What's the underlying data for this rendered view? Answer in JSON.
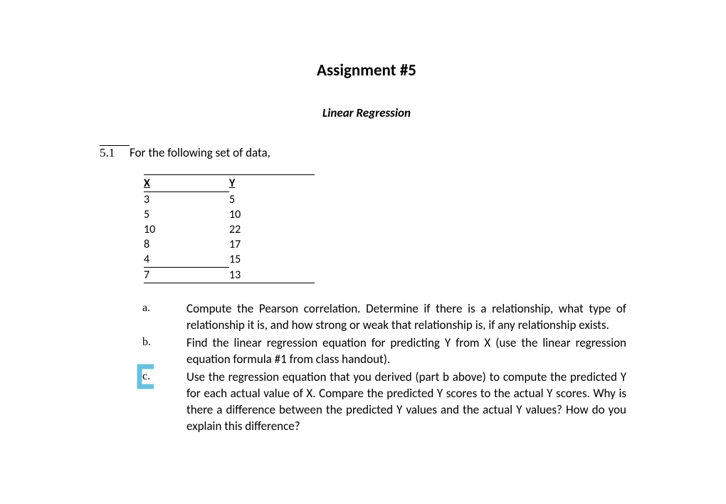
{
  "title": "Assignment #5",
  "subtitle": "Linear Regression",
  "question": {
    "number": "5.1",
    "text": "For the following set of data,"
  },
  "table": {
    "headers": {
      "x": "X",
      "y": "Y"
    },
    "rows": [
      {
        "x": "3",
        "y": "5"
      },
      {
        "x": "5",
        "y": "10"
      },
      {
        "x": "10",
        "y": "22"
      },
      {
        "x": "8",
        "y": "17"
      },
      {
        "x": "4",
        "y": "15"
      },
      {
        "x": "7",
        "y": "13"
      }
    ]
  },
  "parts": {
    "a": {
      "label": "a.",
      "text": "Compute the Pearson correlation. Determine if there is a relationship, what type of relationship it is, and how strong or weak that relationship is, if any relationship exists."
    },
    "b": {
      "label": "b.",
      "text": "Find the linear regression equation for predicting Y from X (use the linear regression equation formula #1 from class handout)."
    },
    "c": {
      "label": "c.",
      "text": "Use the regression equation that you derived (part b above) to compute the predicted Y for each actual value of X. Compare the predicted Y scores to the actual Y scores. Why is there a difference between the predicted Y values and the actual Y values? How do you explain this difference?"
    }
  },
  "highlight_color": "#6ac0de"
}
